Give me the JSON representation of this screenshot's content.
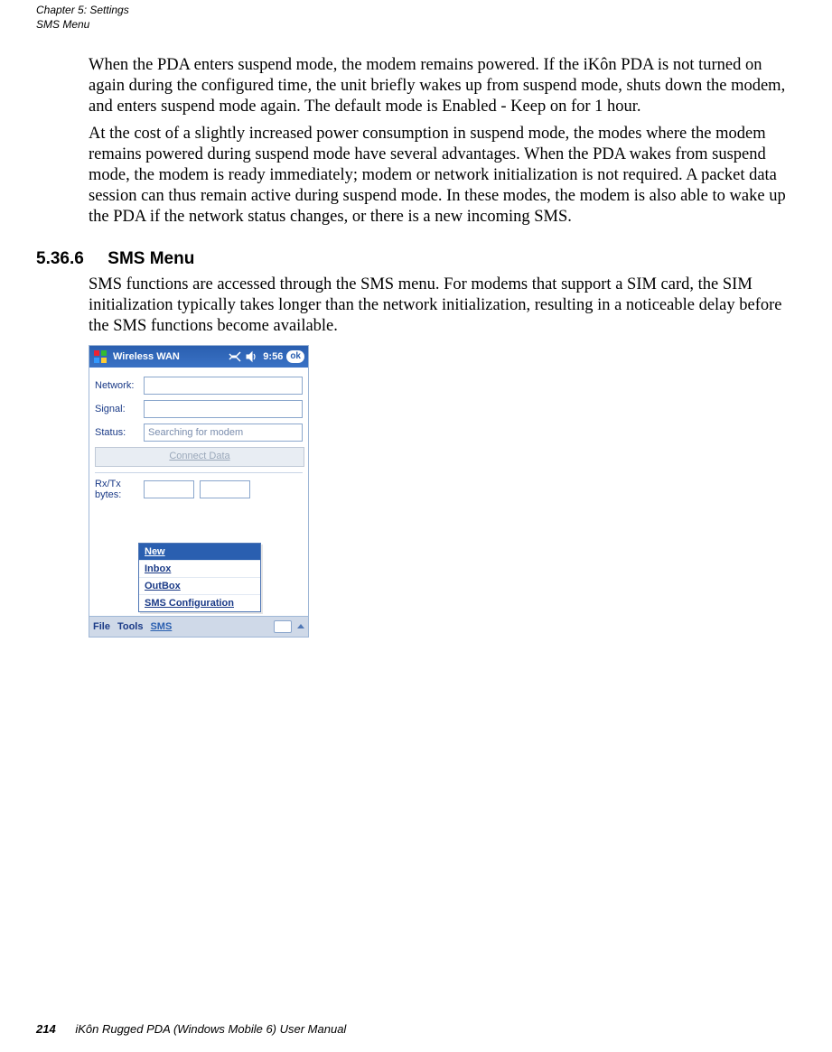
{
  "header": {
    "chapter_line": "Chapter 5: Settings",
    "section_line": "SMS Menu"
  },
  "paragraphs": {
    "p1": "When the PDA enters suspend mode, the modem remains powered. If the iKôn PDA is not turned on again during the configured time, the unit briefly wakes up from suspend mode, shuts down the modem, and enters suspend mode again. The default mode is Enabled - Keep on for 1 hour.",
    "p2": "At the cost of a slightly increased power consumption in suspend mode, the modes where the modem remains powered during suspend mode have several advantages. When the PDA wakes from suspend mode, the modem is ready immediately; modem or network initialization is not required. A packet data session can thus remain active during suspend mode. In these modes, the modem is also able to wake up the PDA if the network status changes, or there is a new incoming SMS.",
    "p3": "SMS functions are accessed through the SMS menu. For modems that support a SIM card, the SIM initialization typically takes longer than the network initialization, resulting in a noticeable delay before the SMS functions become available."
  },
  "section": {
    "number": "5.36.6",
    "title": "SMS Menu"
  },
  "pda": {
    "title": "Wireless WAN",
    "clock": "9:56",
    "ok": "ok",
    "labels": {
      "network": "Network:",
      "signal": "Signal:",
      "status": "Status:",
      "rxtx": "Rx/Tx\nbytes:"
    },
    "status_value": "Searching for modem",
    "connect_btn": "Connect Data",
    "menu": {
      "new": "New",
      "inbox": "Inbox",
      "outbox": "OutBox",
      "config": "SMS Configuration"
    },
    "bottombar": {
      "file": "File",
      "tools": "Tools",
      "sms": "SMS"
    }
  },
  "footer": {
    "page": "214",
    "title": "iKôn Rugged PDA (Windows Mobile 6) User Manual"
  }
}
